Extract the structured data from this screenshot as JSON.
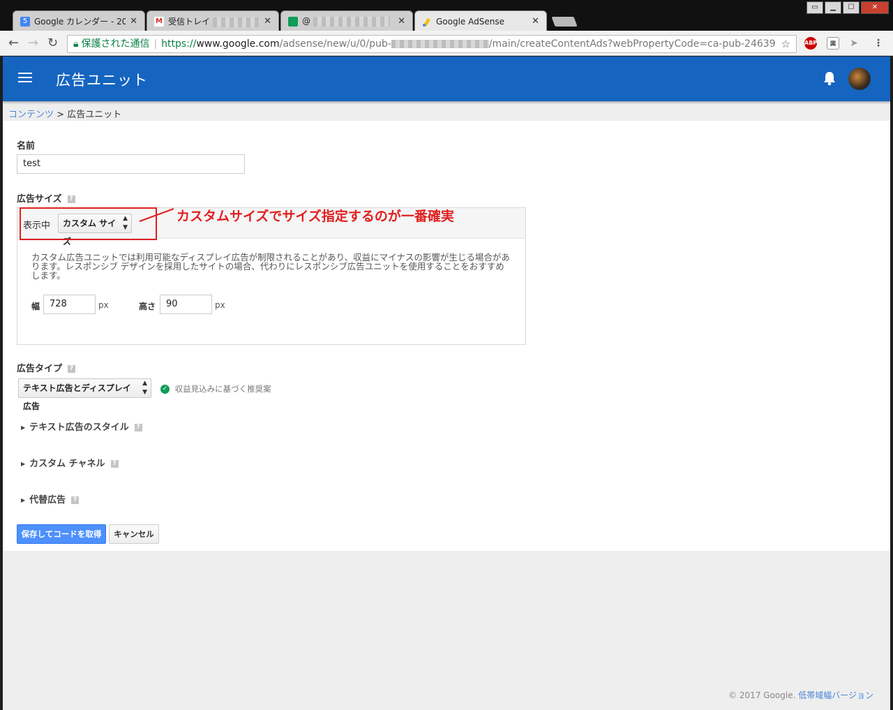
{
  "browser": {
    "tabs": [
      {
        "title": "Google カレンダー - 20",
        "favicon": "calendar-icon",
        "fav_label": "5",
        "fav_color": "#4285f4"
      },
      {
        "title": "受信トレイ",
        "favicon": "gmail-icon",
        "fav_label": "M",
        "fav_color": "#ffffff"
      },
      {
        "title": "@",
        "favicon": "sheets-icon",
        "fav_label": "",
        "fav_color": "#0f9d58"
      },
      {
        "title": "Google AdSense",
        "favicon": "adsense-icon",
        "fav_label": "",
        "fav_color": "#fbbc05"
      }
    ],
    "secure_label": "保護された通信",
    "url_scheme": "https://",
    "url_host": "www.google.com",
    "url_path_1": "/adsense/new/u/0/pub-",
    "url_path_2": "/main/createContentAds?webPropertyCode=ca-pub-24639"
  },
  "appbar": {
    "title": "広告ユニット"
  },
  "breadcrumb": {
    "parent": "コンテンツ",
    "separator": ">",
    "current": "広告ユニット"
  },
  "form": {
    "name_label": "名前",
    "name_value": "test",
    "size_label": "広告サイズ",
    "display_label": "表示中",
    "size_select": "カスタム サイズ",
    "description": "カスタム広告ユニットでは利用可能なディスプレイ広告が制限されることがあり、収益にマイナスの影響が生じる場合があります。レスポンシブ デザインを採用したサイトの場合、代わりにレスポンシブ広告ユニットを使用することをおすすめします。",
    "width_label": "幅",
    "width_value": "728",
    "height_label": "高さ",
    "height_value": "90",
    "unit": "px",
    "type_label": "広告タイプ",
    "type_select": "テキスト広告とディスプレイ広告",
    "recommend": "収益見込みに基づく推奨案",
    "text_style": "テキスト広告のスタイル",
    "custom_channel": "カスタム チャネル",
    "alt_ads": "代替広告",
    "save_button": "保存してコードを取得",
    "cancel_button": "キャンセル",
    "help_glyph": "?"
  },
  "annotation": {
    "text": "カスタムサイズでサイズ指定するのが一番確実"
  },
  "footer": {
    "copyright": "© 2017 Google.",
    "link": "低帯域幅バージョン"
  }
}
